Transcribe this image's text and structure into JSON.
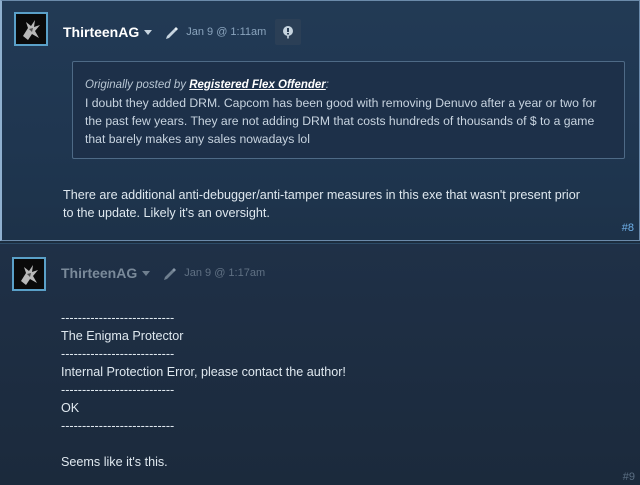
{
  "posts": [
    {
      "author": "ThirteenAG",
      "timestamp": "Jan 9 @ 1:11am",
      "quote": {
        "prefix": "Originally posted by ",
        "author": "Registered Flex Offender",
        "suffix": ":",
        "text": "I doubt they added DRM. Capcom has been good with removing Denuvo after a year or two for the past few years. They are not adding DRM that costs hundreds of thousands of $ to a game that barely makes any sales nowadays lol"
      },
      "body": [
        "There are additional anti-debugger/anti-tamper measures in this exe that wasn't present prior",
        "to the update. Likely it's an oversight."
      ],
      "number": "#8"
    },
    {
      "author": "ThirteenAG",
      "timestamp": "Jan 9 @ 1:17am",
      "body": [
        "---------------------------",
        "The Enigma Protector",
        "---------------------------",
        "Internal Protection Error, please contact the author!",
        "---------------------------",
        "OK",
        "---------------------------",
        "",
        "Seems like it's this."
      ],
      "number": "#9"
    }
  ],
  "icons": {
    "caret": "chevron-down-icon",
    "edit_tool": "pen-icon",
    "report": "flag-icon"
  },
  "colors": {
    "background": "#1b2838",
    "link": "#6fb0e8",
    "avatar_border": "#5aa0c8"
  }
}
